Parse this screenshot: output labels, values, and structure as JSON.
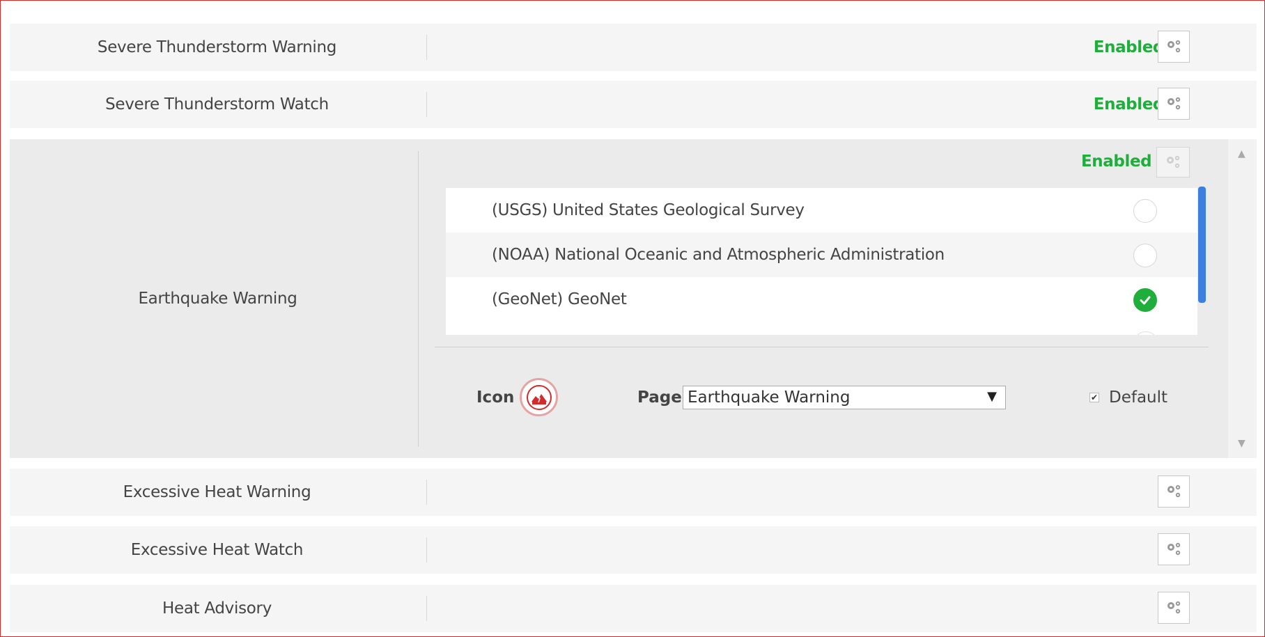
{
  "rows_top": [
    {
      "label": "Severe Thunderstorm Warning",
      "status": "Enabled"
    },
    {
      "label": "Severe Thunderstorm Watch",
      "status": "Enabled"
    }
  ],
  "expanded": {
    "label": "Earthquake Warning",
    "status": "Enabled",
    "sources": [
      {
        "name": "(USGS) United States Geological Survey",
        "selected": false
      },
      {
        "name": "(NOAA) National Oceanic and Atmospheric Administration",
        "selected": false
      },
      {
        "name": "(GeoNet) GeoNet",
        "selected": true
      }
    ],
    "icon_label": "Icon",
    "page_label": "Page",
    "page_value": "Earthquake Warning",
    "default_label": "Default",
    "default_checked": true
  },
  "rows_bottom": [
    {
      "label": "Excessive Heat Warning",
      "status": ""
    },
    {
      "label": "Excessive Heat Watch",
      "status": ""
    },
    {
      "label": "Heat Advisory",
      "status": ""
    }
  ],
  "colors": {
    "enabled_green": "#1fae3b",
    "frame_red": "#d42a2a",
    "scroll_blue": "#3d7fe0"
  },
  "icons": {
    "settings": "gears-icon",
    "check": "check-icon",
    "alert_type": "earthquake-icon",
    "dropdown": "triangle-down-icon"
  }
}
